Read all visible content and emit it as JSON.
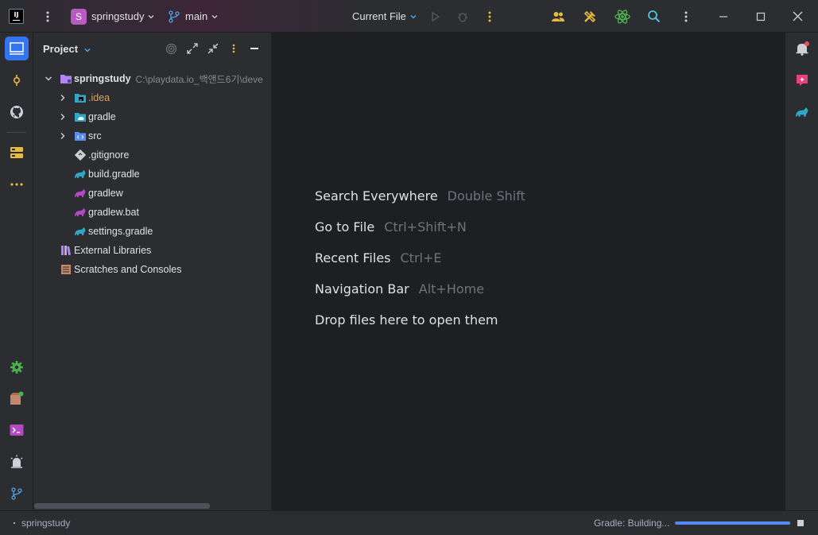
{
  "titlebar": {
    "logo_text": "IJ",
    "project_badge": "S",
    "project_name": "springstudy",
    "branch": "main",
    "run_config": "Current File"
  },
  "project_panel": {
    "title": "Project",
    "tree": [
      {
        "label": "springstudy",
        "path": "C:\\playdata.io_백앤드6기\\deve",
        "icon": "folder-module-icon",
        "depth": 0,
        "expanded": true
      },
      {
        "label": ".idea",
        "icon": "folder-idea-icon",
        "depth": 1,
        "expanded": false
      },
      {
        "label": "gradle",
        "icon": "folder-gradle-icon",
        "depth": 1,
        "expanded": false
      },
      {
        "label": "src",
        "icon": "folder-src-icon",
        "depth": 1,
        "expanded": false
      },
      {
        "label": ".gitignore",
        "icon": "gitignore-icon",
        "depth": 1
      },
      {
        "label": "build.gradle",
        "icon": "gradle-file-icon",
        "depth": 1
      },
      {
        "label": "gradlew",
        "icon": "gradlew-icon",
        "depth": 1
      },
      {
        "label": "gradlew.bat",
        "icon": "gradlew-icon",
        "depth": 1
      },
      {
        "label": "settings.gradle",
        "icon": "gradle-file-icon",
        "depth": 1
      },
      {
        "label": "External Libraries",
        "icon": "external-libraries-icon",
        "depth": 0
      },
      {
        "label": "Scratches and Consoles",
        "icon": "scratches-icon",
        "depth": 0
      }
    ]
  },
  "editor": {
    "hints": [
      {
        "action": "Search Everywhere",
        "shortcut": "Double Shift"
      },
      {
        "action": "Go to File",
        "shortcut": "Ctrl+Shift+N"
      },
      {
        "action": "Recent Files",
        "shortcut": "Ctrl+E"
      },
      {
        "action": "Navigation Bar",
        "shortcut": "Alt+Home"
      },
      {
        "action": "Drop files here to open them",
        "shortcut": ""
      }
    ]
  },
  "statusbar": {
    "breadcrumb": "springstudy",
    "task": "Gradle: Building...",
    "progress_fraction": 0.99
  },
  "colors": {
    "accent": "#3574f0",
    "project_badge": "#b65bbf",
    "commit": "#e8b93a",
    "gradle": "#2fa8c8",
    "gradlew": "#b34ac2"
  }
}
